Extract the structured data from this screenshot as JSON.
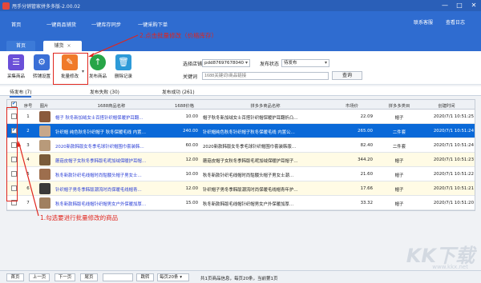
{
  "titlebar": {
    "title": "甩手分销管家拼多多版-2.00.02",
    "minimize": "—",
    "maximize": "□",
    "close": "✕"
  },
  "menu": {
    "items": [
      "首页",
      "一键商品铺货",
      "一键库存同步",
      "一键采购下单"
    ],
    "links": [
      "联系客服",
      "查看日志"
    ]
  },
  "tabs": {
    "home": "首页",
    "active": "铺货",
    "close": "×"
  },
  "toolbar": {
    "buttons": [
      {
        "label": "采集商品",
        "icon": "list-icon"
      },
      {
        "label": "转铺设置",
        "icon": "gear-icon"
      },
      {
        "label": "批量修改",
        "icon": "pencil-icon"
      },
      {
        "label": "发布商品",
        "icon": "upload-icon"
      },
      {
        "label": "删除记录",
        "icon": "trash-icon"
      }
    ],
    "dropdown_marker": "▾",
    "store_label": "选择店铺",
    "store_value": "pdd87697678040",
    "status_label": "发布状态",
    "status_value": "待发布",
    "keyword_label": "关键词",
    "keyword_placeholder": "1688关键词\\商品链接",
    "search_label": "查询"
  },
  "annotations": {
    "top": "2.点击批量修改（价格库存）",
    "bottom": "1.勾选要进行批量修改的商品"
  },
  "subtabs": [
    {
      "label": "待发布",
      "count": "(7)"
    },
    {
      "label": "发布失败",
      "count": "(30)"
    },
    {
      "label": "发布成功",
      "count": "(261)"
    }
  ],
  "table": {
    "columns": [
      "序号",
      "图片",
      "1688商品名称",
      "1688价格",
      "拼多多商品名称",
      "市场价",
      "拼多多类目",
      "创建时间"
    ],
    "rows": [
      {
        "no": "1",
        "title": "帽子 秋冬新加绒女士百搭针织帽保暖护耳翻…",
        "price": "10.00",
        "pdd": "帽子秋冬新加绒女士百搭针织帽保暖护耳翻折凸…",
        "market": "22.09",
        "cat": "帽子",
        "time": "2020/7/1 10:51:25",
        "checked": false,
        "selected": false,
        "thumb": "#8a5a3c"
      },
      {
        "no": "2",
        "title": "针织帽 纯色秋冬针织帽子 秋冬保暖毛线 内置…",
        "price": "240.00",
        "pdd": "针织帽纯色秋冬针织帽子秋冬保暖毛线 内置公…",
        "market": "265.00",
        "cat": "二件套",
        "time": "2020/7/1 10:51:24",
        "checked": true,
        "selected": true,
        "thumb": "#c7a78a"
      },
      {
        "no": "3",
        "title": "2020新款韩版女冬季毛球针织帽围巾套装韩…",
        "price": "60.00",
        "pdd": "2020新款韩版女冬季毛球针织帽围巾套装韩版…",
        "market": "82.40",
        "cat": "二件套",
        "time": "2020/7/1 10:51:24",
        "checked": false,
        "selected": false,
        "thumb": "#b89a7a"
      },
      {
        "no": "4",
        "title": "蘑菇皮帽子女秋冬季韩版毛呢加绒保暖护耳帽…",
        "price": "12.00",
        "pdd": "蘑菇皮帽子女秋冬季韩版毛呢加绒保暖护耳帽子…",
        "market": "344.20",
        "cat": "帽子",
        "time": "2020/7/1 10:51:23",
        "checked": false,
        "selected": false,
        "thumb": "#7a5b3a"
      },
      {
        "no": "5",
        "title": "秋冬新款针织毛线帽时尚骷髅头帽子男女士…",
        "price": "10.00",
        "pdd": "秋冬新款针织毛线帽时尚骷髅头帽子男女士潮…",
        "market": "21.60",
        "cat": "帽子",
        "time": "2020/7/1 10:51:22",
        "checked": false,
        "selected": false,
        "thumb": "#9d6e4d"
      },
      {
        "no": "6",
        "title": "针织帽子男冬季韩版潮流时尚保暖毛线帽青…",
        "price": "12.00",
        "pdd": "针织帽子男冬季韩版潮流时尚保暖毛线帽青年护…",
        "market": "17.66",
        "cat": "帽子",
        "time": "2020/7/1 10:51:21",
        "checked": false,
        "selected": false,
        "thumb": "#3a3a3a"
      },
      {
        "no": "7",
        "title": "秋冬新款韩版毛线帽针织帽男女户外保暖加厚…",
        "price": "15.00",
        "pdd": "秋冬新款韩版毛线帽针织帽男女户外保暖加厚…",
        "market": "33.32",
        "cat": "帽子",
        "time": "2020/7/1 10:51:20",
        "checked": false,
        "selected": false,
        "thumb": "#a08060"
      }
    ]
  },
  "footer": {
    "first": "首页",
    "prev": "上一页",
    "next": "下一页",
    "last": "尾页",
    "page_input": "",
    "jump": "跳转",
    "page_size": "每页20条",
    "summary": "共1页商品信息，每页20条，当前第1页"
  },
  "colors": {
    "accent": "#2f6cd0",
    "selected_row": "#0a69d8",
    "annotation": "#e0251d"
  },
  "watermark": {
    "big": "KK下载",
    "small": "www.kkx.net"
  }
}
